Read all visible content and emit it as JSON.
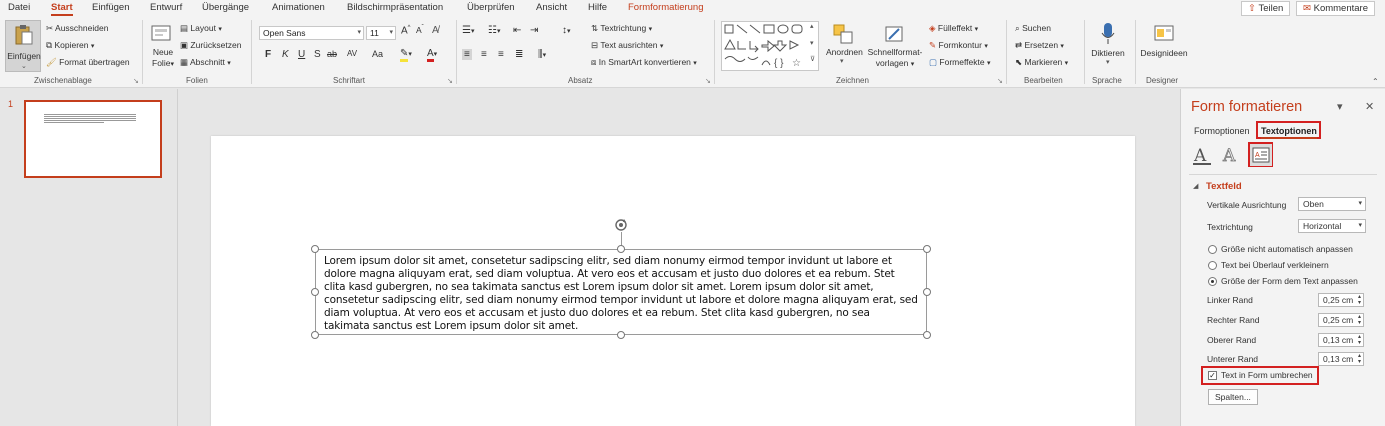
{
  "tabs": [
    "Datei",
    "Start",
    "Einfügen",
    "Entwurf",
    "Übergänge",
    "Animationen",
    "Bildschirmpräsentation",
    "Überprüfen",
    "Ansicht",
    "Hilfe",
    "Formformatierung"
  ],
  "header_actions": {
    "share": "Teilen",
    "comments": "Kommentare"
  },
  "ribbon": {
    "clipboard": {
      "paste": "Einfügen",
      "cut": "Ausschneiden",
      "copy": "Kopieren",
      "format_painter": "Format übertragen",
      "label": "Zwischenablage"
    },
    "slides": {
      "new_slide_1": "Neue",
      "new_slide_2": "Folie",
      "layout": "Layout",
      "reset": "Zurücksetzen",
      "section": "Abschnitt",
      "label": "Folien"
    },
    "font": {
      "font_name": "Open Sans",
      "font_size": "11",
      "bold": "F",
      "italic": "K",
      "underline": "U",
      "shadow": "S",
      "strike": "ab",
      "spacing": "AV",
      "case": "Aa",
      "label": "Schriftart"
    },
    "paragraph": {
      "direction": "Textrichtung",
      "align_text": "Text ausrichten",
      "smartart": "In SmartArt konvertieren",
      "label": "Absatz"
    },
    "drawing": {
      "arrange": "Anordnen",
      "quick_styles_1": "Schnellformat-",
      "quick_styles_2": "vorlagen",
      "fill": "Fülleffekt",
      "outline": "Formkontur",
      "effects": "Formeffekte",
      "label": "Zeichnen"
    },
    "editing": {
      "find": "Suchen",
      "replace": "Ersetzen",
      "select": "Markieren",
      "label": "Bearbeiten"
    },
    "voice": {
      "dictate": "Diktieren",
      "label": "Sprache"
    },
    "designer": {
      "ideas": "Designideen",
      "label": "Designer"
    }
  },
  "thumbnail": {
    "number": "1"
  },
  "slide": {
    "text": "Lorem ipsum dolor sit amet, consetetur sadipscing elitr, sed diam nonumy eirmod tempor invidunt ut labore et dolore magna aliquyam erat, sed diam voluptua. At vero eos et accusam et justo duo dolores et ea rebum. Stet clita kasd gubergren, no sea takimata sanctus est Lorem ipsum dolor sit amet. Lorem ipsum dolor sit amet, consetetur sadipscing elitr, sed diam nonumy eirmod tempor invidunt ut labore et dolore magna aliquyam erat, sed diam voluptua. At vero eos et accusam et justo duo dolores et ea rebum. Stet clita kasd gubergren, no sea takimata sanctus est Lorem ipsum dolor sit amet."
  },
  "format_pane": {
    "title": "Form formatieren",
    "tab_shape": "Formoptionen",
    "tab_text": "Textoptionen",
    "section": "Textfeld",
    "vertical_align_label": "Vertikale Ausrichtung",
    "vertical_align_value": "Oben",
    "direction_label": "Textrichtung",
    "direction_value": "Horizontal",
    "radio_1": "Größe nicht automatisch anpassen",
    "radio_2": "Text bei Überlauf verkleinern",
    "radio_3": "Größe der Form dem Text anpassen",
    "left_margin_label": "Linker Rand",
    "left_margin_value": "0,25 cm",
    "right_margin_label": "Rechter Rand",
    "right_margin_value": "0,25 cm",
    "top_margin_label": "Oberer Rand",
    "top_margin_value": "0,13 cm",
    "bottom_margin_label": "Unterer Rand",
    "bottom_margin_value": "0,13 cm",
    "wrap_label": "Text in Form umbrechen",
    "columns_button": "Spalten..."
  },
  "colors": {
    "accent": "#c43e1c",
    "highlight": "#d32020"
  }
}
